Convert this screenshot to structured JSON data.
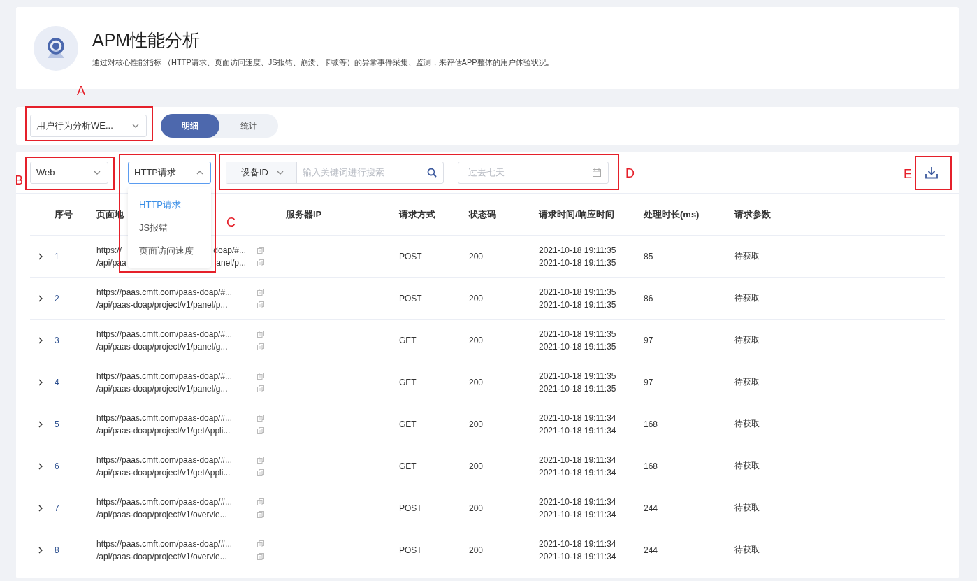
{
  "header": {
    "title": "APM性能分析",
    "description": "通过对核心性能指标 （HTTP请求、页面访问速度、JS报错、崩溃、卡顿等）的异常事件采集、监测，来评估APP整体的用户体验状况。"
  },
  "toolbar": {
    "app_select": {
      "value": "用户行为分析WE..."
    },
    "segments": [
      {
        "label": "明细",
        "selected": true
      },
      {
        "label": "统计",
        "selected": false
      }
    ]
  },
  "filters": {
    "platform_select": {
      "value": "Web"
    },
    "type_select": {
      "value": "HTTP请求",
      "expanded": true,
      "options": [
        {
          "label": "HTTP请求",
          "selected": true
        },
        {
          "label": "JS报错",
          "selected": false
        },
        {
          "label": "页面访问速度",
          "selected": false
        }
      ]
    },
    "search": {
      "field_select": "设备ID",
      "placeholder": "输入关键词进行搜索"
    },
    "date_range": {
      "placeholder": "过去七天"
    }
  },
  "annotations": [
    {
      "label": "A"
    },
    {
      "label": "B"
    },
    {
      "label": "C"
    },
    {
      "label": "D"
    },
    {
      "label": "E"
    }
  ],
  "table": {
    "columns": [
      "序号",
      "页面地",
      "服务器IP",
      "请求方式",
      "状态码",
      "请求时间/响应时间",
      "处理时长(ms)",
      "请求参数"
    ],
    "rows": [
      {
        "index": "1",
        "page_url": "https://",
        "page_url_tail": "doap/#...",
        "api_path": "/api/paa",
        "api_path_tail": "anel/p...",
        "method": "POST",
        "status": "200",
        "request_time": "2021-10-18 19:11:35",
        "response_time": "2021-10-18 19:11:35",
        "duration": "85",
        "params": "待获取"
      },
      {
        "index": "2",
        "page_url": "https://paas.cmft.com/paas-doap/#...",
        "api_path": "/api/paas-doap/project/v1/panel/p...",
        "method": "POST",
        "status": "200",
        "request_time": "2021-10-18 19:11:35",
        "response_time": "2021-10-18 19:11:35",
        "duration": "86",
        "params": "待获取"
      },
      {
        "index": "3",
        "page_url": "https://paas.cmft.com/paas-doap/#...",
        "api_path": "/api/paas-doap/project/v1/panel/g...",
        "method": "GET",
        "status": "200",
        "request_time": "2021-10-18 19:11:35",
        "response_time": "2021-10-18 19:11:35",
        "duration": "97",
        "params": "待获取"
      },
      {
        "index": "4",
        "page_url": "https://paas.cmft.com/paas-doap/#...",
        "api_path": "/api/paas-doap/project/v1/panel/g...",
        "method": "GET",
        "status": "200",
        "request_time": "2021-10-18 19:11:35",
        "response_time": "2021-10-18 19:11:35",
        "duration": "97",
        "params": "待获取"
      },
      {
        "index": "5",
        "page_url": "https://paas.cmft.com/paas-doap/#...",
        "api_path": "/api/paas-doap/project/v1/getAppli...",
        "method": "GET",
        "status": "200",
        "request_time": "2021-10-18 19:11:34",
        "response_time": "2021-10-18 19:11:34",
        "duration": "168",
        "params": "待获取"
      },
      {
        "index": "6",
        "page_url": "https://paas.cmft.com/paas-doap/#...",
        "api_path": "/api/paas-doap/project/v1/getAppli...",
        "method": "GET",
        "status": "200",
        "request_time": "2021-10-18 19:11:34",
        "response_time": "2021-10-18 19:11:34",
        "duration": "168",
        "params": "待获取"
      },
      {
        "index": "7",
        "page_url": "https://paas.cmft.com/paas-doap/#...",
        "api_path": "/api/paas-doap/project/v1/overvie...",
        "method": "POST",
        "status": "200",
        "request_time": "2021-10-18 19:11:34",
        "response_time": "2021-10-18 19:11:34",
        "duration": "244",
        "params": "待获取"
      },
      {
        "index": "8",
        "page_url": "https://paas.cmft.com/paas-doap/#...",
        "api_path": "/api/paas-doap/project/v1/overvie...",
        "method": "POST",
        "status": "200",
        "request_time": "2021-10-18 19:11:34",
        "response_time": "2021-10-18 19:11:34",
        "duration": "244",
        "params": "待获取"
      }
    ]
  }
}
